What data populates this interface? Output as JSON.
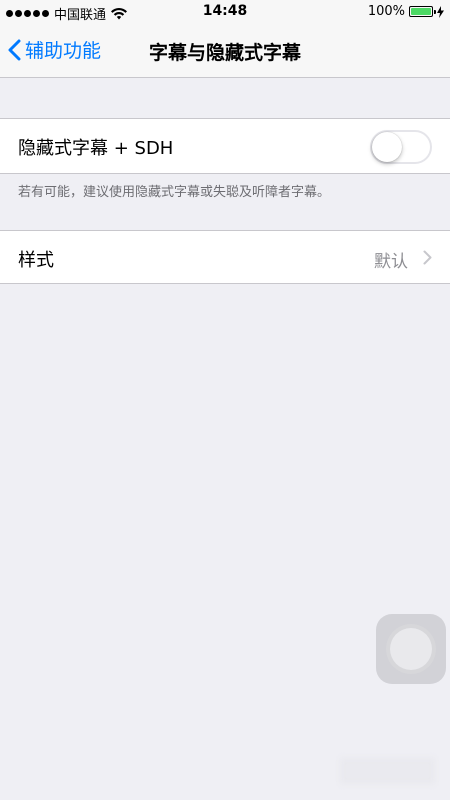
{
  "status_bar": {
    "carrier": "中国联通",
    "time": "14:48",
    "battery_percent": "100%",
    "battery_level": 1.0,
    "battery_color": "#4cd964"
  },
  "nav": {
    "back_label": "辅助功能",
    "title": "字幕与隐藏式字幕"
  },
  "settings": {
    "closed_captions": {
      "label": "隐藏式字幕 + SDH",
      "enabled": false
    },
    "footer": "若有可能，建议使用隐藏式字幕或失聪及听障者字幕。",
    "style": {
      "label": "样式",
      "value": "默认"
    }
  },
  "colors": {
    "accent": "#007aff",
    "background": "#efeff4",
    "secondary_text": "#8e8e93"
  },
  "icons": {
    "back": "chevron-left-icon",
    "disclosure": "chevron-right-icon",
    "wifi": "wifi-icon",
    "battery": "battery-icon",
    "charging": "charging-icon"
  }
}
